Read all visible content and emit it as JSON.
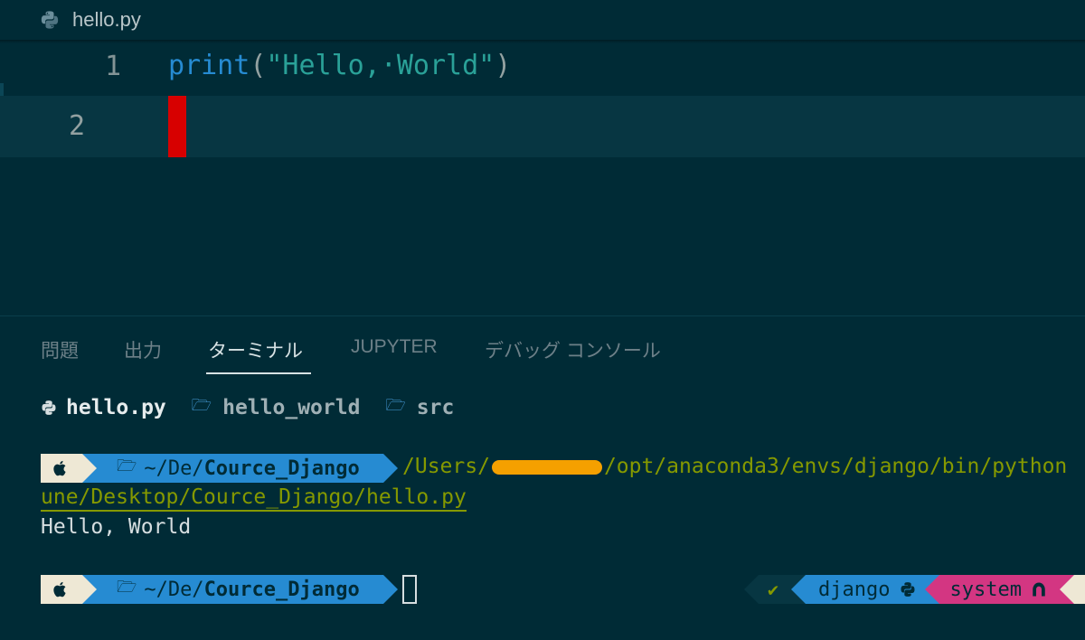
{
  "editor": {
    "tab_label": "hello.py",
    "lines": [
      {
        "number": "1",
        "fn": "print",
        "open": "(",
        "string": "\"Hello,·World\"",
        "close": ")"
      },
      {
        "number": "2"
      }
    ]
  },
  "panel": {
    "tabs": [
      "問題",
      "出力",
      "ターミナル",
      "JUPYTER",
      "デバッグ コンソール"
    ],
    "active_tab": "ターミナル"
  },
  "terminal": {
    "breadcrumbs": [
      {
        "icon": "python-icon",
        "label": "hello.py"
      },
      {
        "icon": "folder-icon",
        "label": "hello_world"
      },
      {
        "icon": "folder-icon",
        "label": "src"
      }
    ],
    "prompt_path_prefix": "~/De/",
    "prompt_path_dir": "Cource_Django",
    "command_part1": "/Users/",
    "command_part2": "/opt/anaconda3/envs/django/bin/python",
    "command_continued": "une/Desktop/Cource_Django/hello.py",
    "output": "Hello, World",
    "right_prompt": {
      "status": "✔",
      "env": "django",
      "system": "system"
    }
  },
  "colors": {
    "background": "#002b36",
    "prompt_blue": "#268bd2",
    "prompt_pink": "#d33682",
    "prompt_cream": "#eee8d5",
    "cursor_red": "#d70000",
    "command_green": "#859900",
    "redaction": "#f5a000"
  }
}
